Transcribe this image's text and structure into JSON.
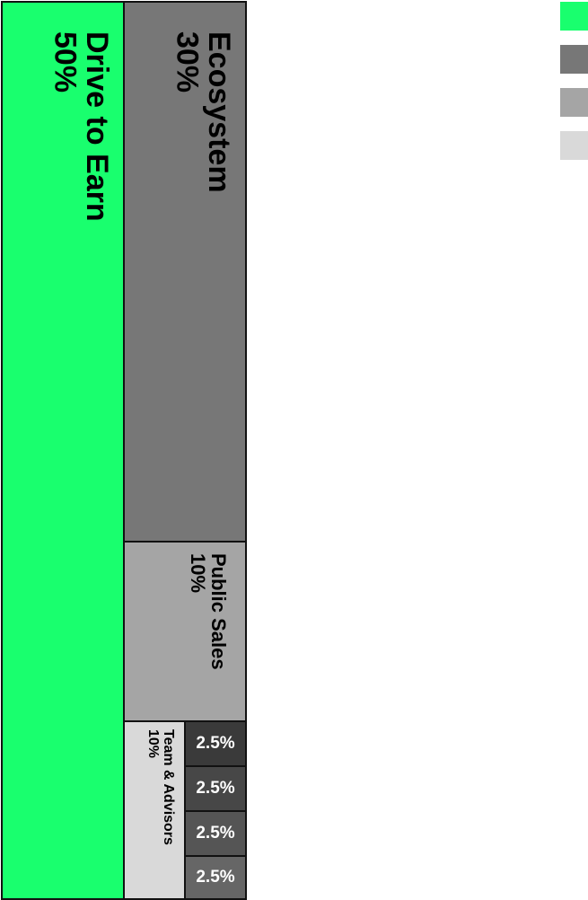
{
  "chart_data": {
    "type": "treemap",
    "items": [
      {
        "name": "Drive to Earn",
        "label": "50%",
        "value": 50,
        "color": "#19ff6e"
      },
      {
        "name": "Ecosystem",
        "label": "30%",
        "value": 30,
        "color": "#777777"
      },
      {
        "name": "Public Sales",
        "label": "10%",
        "value": 10,
        "color": "#a5a5a5"
      },
      {
        "name": "Team & Advisors",
        "label": "10%",
        "value": 10,
        "color": "#d9d9d9"
      },
      {
        "name": "",
        "label": "2.5%",
        "value": 2.5,
        "color": "#3a3a3a"
      },
      {
        "name": "",
        "label": "2.5%",
        "value": 2.5,
        "color": "#474747"
      },
      {
        "name": "",
        "label": "2.5%",
        "value": 2.5,
        "color": "#555555"
      },
      {
        "name": "",
        "label": "2.5%",
        "value": 2.5,
        "color": "#666666"
      }
    ],
    "legend": {
      "placement": "top-right",
      "colors": [
        "#19ff6e",
        "#777777",
        "#a5a5a5",
        "#d9d9d9"
      ]
    }
  }
}
